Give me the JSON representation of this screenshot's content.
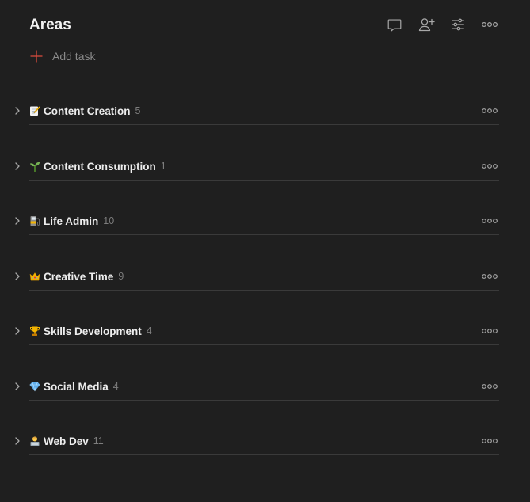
{
  "header": {
    "title": "Areas",
    "actions": [
      {
        "icon": "comment-icon"
      },
      {
        "icon": "share-person-icon"
      },
      {
        "icon": "view-options-icon"
      },
      {
        "icon": "more-icon"
      }
    ]
  },
  "add_task": {
    "label": "Add task",
    "icon": "plus-icon",
    "icon_color": "#dc4c3e"
  },
  "sections": [
    {
      "emoji": "memo-emoji",
      "name": "Content Creation",
      "count": "5"
    },
    {
      "emoji": "seedling-emoji",
      "name": "Content Consumption",
      "count": "1"
    },
    {
      "emoji": "fuel-pump-emoji",
      "name": "Life Admin",
      "count": "10"
    },
    {
      "emoji": "crown-emoji",
      "name": "Creative Time",
      "count": "9"
    },
    {
      "emoji": "trophy-emoji",
      "name": "Skills Development",
      "count": "4"
    },
    {
      "emoji": "gem-emoji",
      "name": "Social Media",
      "count": "4"
    },
    {
      "emoji": "technologist-emoji",
      "name": "Web Dev",
      "count": "11"
    }
  ],
  "colors": {
    "background": "#1f1f1f",
    "title": "#f2f2f2",
    "muted": "#8a8a8a",
    "divider": "#3a3a3a"
  }
}
